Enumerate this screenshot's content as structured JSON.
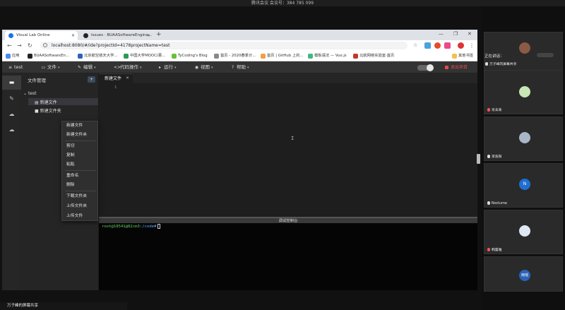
{
  "meeting": {
    "title": "腾讯会议 会议号：384 785 099",
    "sharing_label": "万子峰的屏幕共享",
    "speaking_label": "正在讲话：",
    "participants": [
      {
        "name": "万子峰的屏幕共享",
        "avatar": "",
        "avatar_color": "#8a5a44"
      },
      {
        "name": "肖未来",
        "avatar": "",
        "avatar_color": "#c9e6b5"
      },
      {
        "name": "李浩阳",
        "avatar": "",
        "avatar_color": "#a9b6c8"
      },
      {
        "name": "Nocturne",
        "avatar": "N",
        "avatar_color": "#1f6fd1"
      },
      {
        "name": "韩蕾雅",
        "avatar": "",
        "avatar_color": "#dfe8f2"
      },
      {
        "name": "",
        "avatar": "雨瑶",
        "avatar_color": "#2b63b8"
      }
    ]
  },
  "browser": {
    "tabs": [
      {
        "title": "Visual Lab Online",
        "icon_color": "#1a73e8"
      },
      {
        "title": "Issues · BUAASoftwareEngine...",
        "icon_color": "#222222"
      }
    ],
    "new_tab": "+",
    "url": "localhost:8080/#/ide?projectId=4178projectName=test",
    "bookmarks": [
      {
        "label": "应用",
        "color": "#4a8af4"
      },
      {
        "label": "BUAASoftwareEn...",
        "color": "#222222"
      },
      {
        "label": "北京航空航天大学...",
        "color": "#2b63b8"
      },
      {
        "label": "中国大学MOOC(慕...",
        "color": "#2c9b55"
      },
      {
        "label": "TyCoding's Blog",
        "color": "#6abf3c"
      },
      {
        "label": "首页 - 2020春季计...",
        "color": "#888888"
      },
      {
        "label": "首页 | GitHub 上的...",
        "color": "#f0a040"
      },
      {
        "label": "模板语法 — Vue.js",
        "color": "#41b883"
      },
      {
        "label": "北航网络实验室·首页",
        "color": "#c0392b"
      },
      {
        "label": "其他书签",
        "color": "#f2c14e"
      }
    ]
  },
  "ide": {
    "project": "test",
    "menus": [
      {
        "label": "文件",
        "icon": "file-icon"
      },
      {
        "label": "编辑",
        "icon": "edit-icon"
      },
      {
        "label": "代码操作",
        "icon": "code-icon"
      },
      {
        "label": "运行",
        "icon": "run-icon"
      },
      {
        "label": "视图",
        "icon": "view-icon"
      },
      {
        "label": "帮助",
        "icon": "help-icon"
      }
    ],
    "exit_label": "退出项目",
    "explorer_title": "文件管理",
    "explorer_add": "+",
    "tree": {
      "root": "test",
      "items": [
        "新建文件",
        "新建文件夹"
      ]
    },
    "context_menu": [
      "新建文件",
      "新建文件夹",
      "剪切",
      "复制",
      "粘贴",
      "重命名",
      "删除",
      "下载文件夹",
      "上传文件夹",
      "上传文件"
    ],
    "editor_tab": "新建文件",
    "line_number": "1",
    "console_title": "调试控制台",
    "console_prompt_user": "root@18541@82cm3",
    "console_prompt_path": ":/code#"
  }
}
